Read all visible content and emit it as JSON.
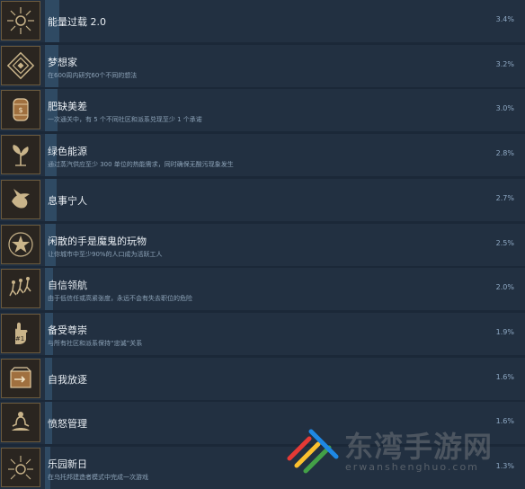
{
  "achievements": [
    {
      "title": "能量过载 2.0",
      "desc": "",
      "percent": "3.4%",
      "fill": 0.034,
      "icon": "sun-burst-icon"
    },
    {
      "title": "梦想家",
      "desc": "在600周内研究60个不同的想法",
      "percent": "3.2%",
      "fill": 0.032,
      "icon": "diamond-pattern-icon"
    },
    {
      "title": "肥缺美差",
      "desc": "一次通关中，有 5 个不同社区和派系兑现至少 1 个承诺",
      "percent": "3.0%",
      "fill": 0.03,
      "icon": "barrel-icon"
    },
    {
      "title": "绿色能源",
      "desc": "通过蒸汽供应至少 300 单位的热能需求，同时确保无酸污现象发生",
      "percent": "2.8%",
      "fill": 0.028,
      "icon": "plant-icon"
    },
    {
      "title": "息事宁人",
      "desc": "",
      "percent": "2.7%",
      "fill": 0.027,
      "icon": "dove-icon"
    },
    {
      "title": "闲散的手是魔鬼的玩物",
      "desc": "让你城市中至少90%的人口成为活跃工人",
      "percent": "2.5%",
      "fill": 0.025,
      "icon": "star-emblem-icon"
    },
    {
      "title": "自信领航",
      "desc": "由于低信任或高紧张度，永远不会有失去职位的危险",
      "percent": "2.0%",
      "fill": 0.02,
      "icon": "running-people-icon"
    },
    {
      "title": "备受尊崇",
      "desc": "与所有社区和派系保持“忠诚”关系",
      "percent": "1.9%",
      "fill": 0.019,
      "icon": "foam-finger-icon"
    },
    {
      "title": "自我放逐",
      "desc": "",
      "percent": "1.6%",
      "fill": 0.016,
      "icon": "exit-box-icon"
    },
    {
      "title": "愤怒管理",
      "desc": "",
      "percent": "1.6%",
      "fill": 0.016,
      "icon": "meditation-icon"
    },
    {
      "title": "乐园新日",
      "desc": "在乌托邦建造者模式中完成一次游戏",
      "percent": "1.3%",
      "fill": 0.013,
      "icon": "sunrise-icon"
    }
  ],
  "watermark": {
    "text": "东湾手游网",
    "sub": "erwanshenghuo.com"
  },
  "colors": {
    "background": "#1b2838",
    "row": "#223041",
    "bar": "#2f4a63",
    "percent": "#8fa9c4"
  }
}
